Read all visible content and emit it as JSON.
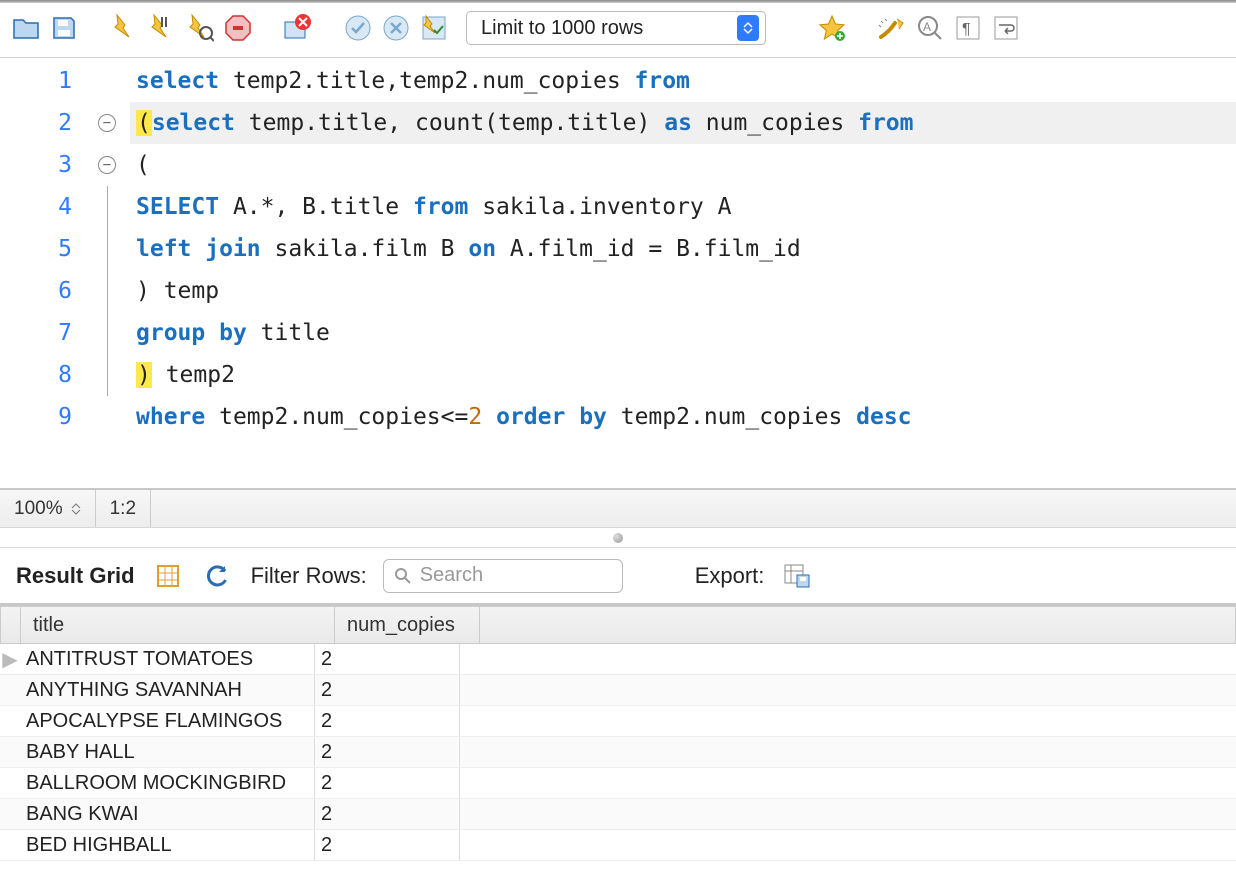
{
  "toolbar": {
    "limit_label": "Limit to 1000 rows"
  },
  "code": {
    "lines": [
      {
        "n": "1"
      },
      {
        "n": "2",
        "fold": true
      },
      {
        "n": "3",
        "fold": true
      },
      {
        "n": "4"
      },
      {
        "n": "5"
      },
      {
        "n": "6"
      },
      {
        "n": "7"
      },
      {
        "n": "8"
      },
      {
        "n": "9"
      }
    ],
    "l1": {
      "a": "select",
      "b": " temp2.title,temp2.num_copies ",
      "c": "from"
    },
    "l2": {
      "p": "(",
      "a": "select",
      "b": " temp.title, count(temp.title) ",
      "c": "as",
      "d": " num_copies ",
      "e": "from"
    },
    "l3": {
      "a": "("
    },
    "l4": {
      "a": "SELECT",
      "b": " A.*, B.title ",
      "c": "from",
      "d": " sakila.inventory A"
    },
    "l5": {
      "a": "left",
      "b": " ",
      "c": "join",
      "d": " sakila.film B ",
      "e": "on",
      "f": " A.film_id = B.film_id"
    },
    "l6": {
      "a": ") temp"
    },
    "l7": {
      "a": "group",
      "b": " ",
      "c": "by",
      "d": " title"
    },
    "l8": {
      "p": ")",
      "a": " temp2"
    },
    "l9": {
      "a": "where",
      "b": " temp2.num_copies<=",
      "n": "2",
      "c": " ",
      "d": "order",
      "e": " ",
      "f": "by",
      "g": " temp2.num_copies ",
      "h": "desc"
    }
  },
  "statusbar": {
    "zoom": "100%",
    "pos": "1:2"
  },
  "result_toolbar": {
    "title": "Result Grid",
    "filter_label": "Filter Rows:",
    "search_placeholder": "Search",
    "export_label": "Export:"
  },
  "grid": {
    "headers": {
      "c1": "title",
      "c2": "num_copies"
    },
    "rows": [
      {
        "title": "ANTITRUST TOMATOES",
        "num_copies": "2",
        "ptr": true
      },
      {
        "title": "ANYTHING SAVANNAH",
        "num_copies": "2"
      },
      {
        "title": "APOCALYPSE FLAMINGOS",
        "num_copies": "2"
      },
      {
        "title": "BABY HALL",
        "num_copies": "2"
      },
      {
        "title": "BALLROOM MOCKINGBIRD",
        "num_copies": "2"
      },
      {
        "title": "BANG KWAI",
        "num_copies": "2"
      },
      {
        "title": "BED HIGHBALL",
        "num_copies": "2"
      }
    ]
  }
}
